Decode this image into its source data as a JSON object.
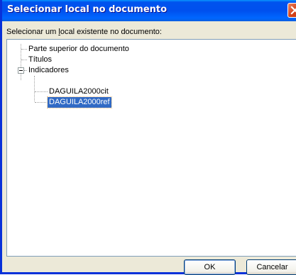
{
  "dialog": {
    "title": "Selecionar local no documento",
    "prompt_before": "Selecionar um ",
    "prompt_accel": "l",
    "prompt_after": "ocal existente no documento:"
  },
  "tree": {
    "items": [
      {
        "label": "Parte superior do documento"
      },
      {
        "label": "Títulos"
      },
      {
        "label": "Indicadores",
        "expanded": true,
        "children": [
          {
            "label": "DAGUILA2000cit"
          },
          {
            "label": "DAGUILA2000ref",
            "selected": true
          }
        ]
      }
    ]
  },
  "buttons": {
    "ok": "OK",
    "cancel": "Cancelar"
  },
  "colors": {
    "titlebar": "#0053ee",
    "selection": "#316ac5",
    "close": "#d44117"
  }
}
